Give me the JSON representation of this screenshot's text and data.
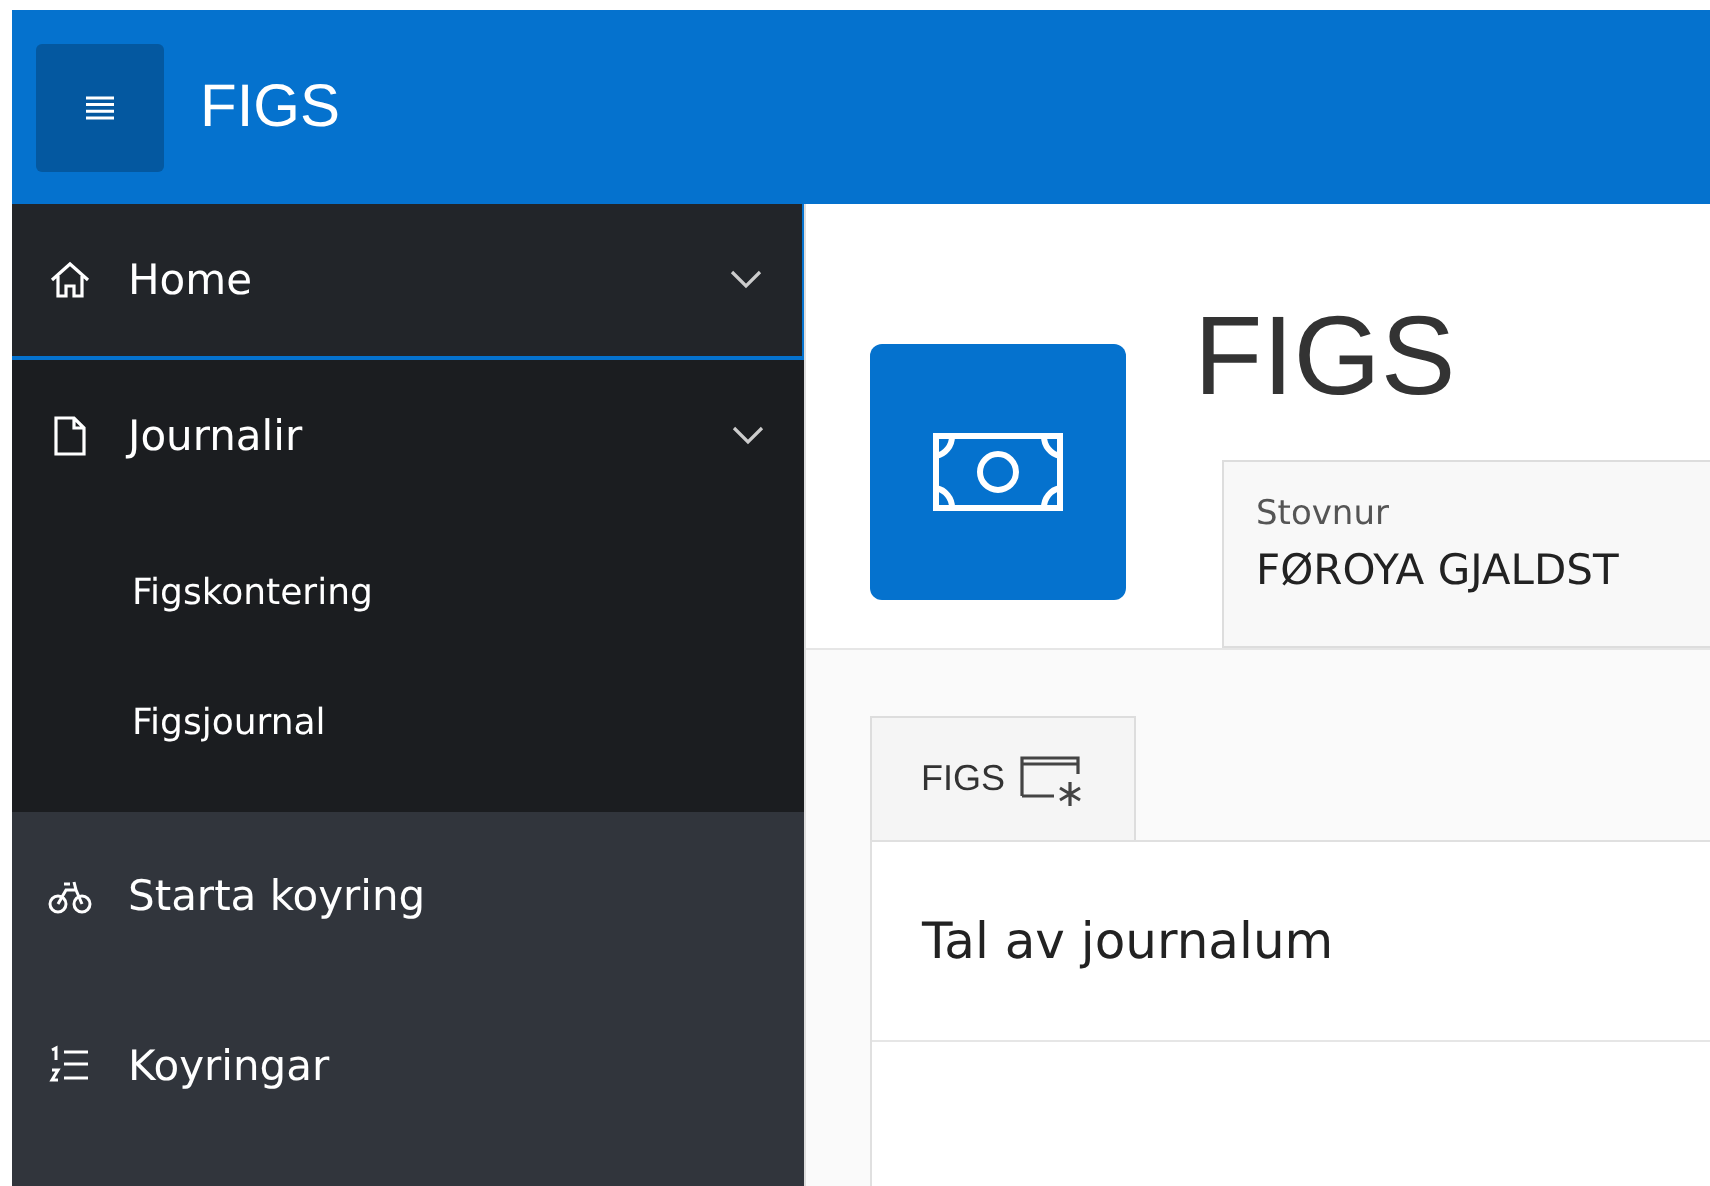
{
  "header": {
    "title": "FIGS"
  },
  "nav": [
    {
      "label": "Home",
      "kind": "group",
      "selected": true,
      "expanded": false
    },
    {
      "label": "Journalir",
      "kind": "group",
      "selected": false,
      "expanded": true,
      "children": [
        {
          "label": "Figskontering",
          "selected": false
        },
        {
          "label": "Figsjournal",
          "selected": false
        }
      ]
    },
    {
      "label": "Starta koyring",
      "kind": "link",
      "selected": false
    },
    {
      "label": "Koyringar",
      "kind": "link",
      "selected": false
    }
  ],
  "page": {
    "title": "FIGS",
    "field": {
      "label": "Stovnur",
      "value": "FØROYA GJALDST"
    }
  },
  "tabs": [
    {
      "label": "FIGS",
      "selected": true
    }
  ],
  "card": {
    "title": "Tal av journalum"
  }
}
